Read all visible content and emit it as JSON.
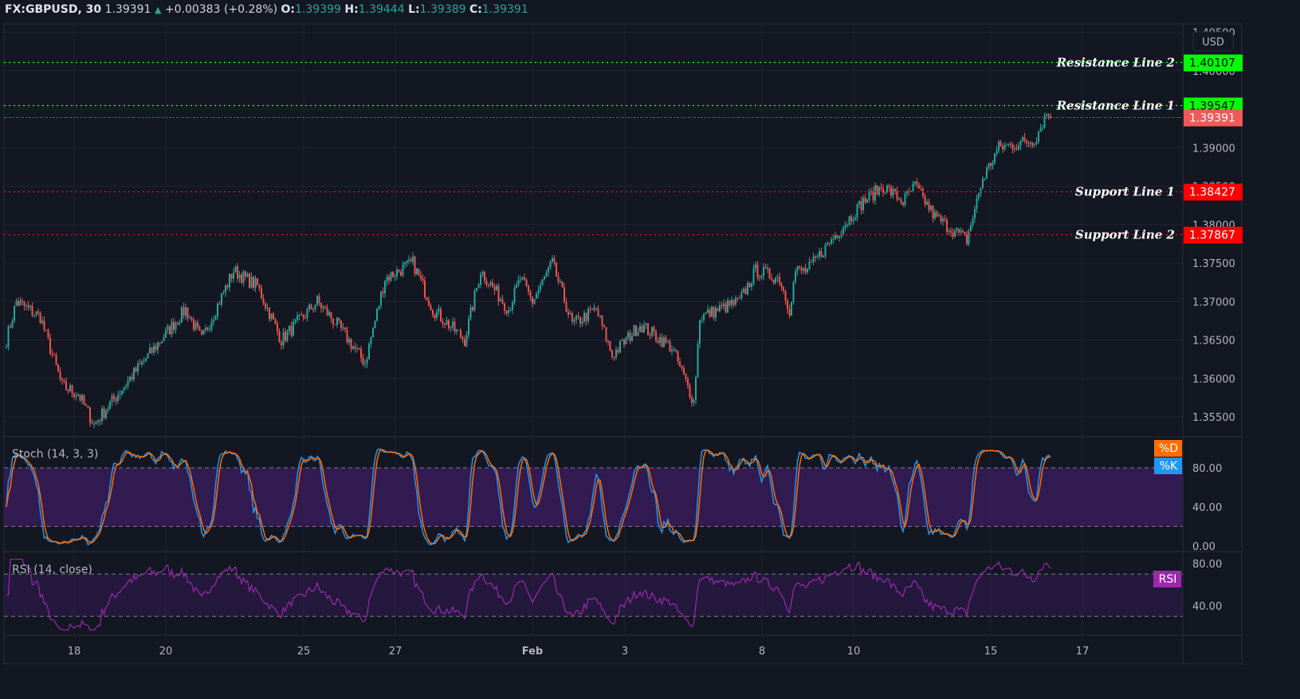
{
  "header": {
    "symbol": "FX:GBPUSD, 30",
    "last": "1.39391",
    "change": "+0.00383 (+0.28%)",
    "o_label": "O:",
    "o": "1.39399",
    "h_label": "H:",
    "h": "1.39444",
    "l_label": "L:",
    "l": "1.39389",
    "c_label": "C:",
    "c": "1.39391",
    "direction_icon": "triangle-up"
  },
  "currency": "USD",
  "colors": {
    "up": "#26a69a",
    "down": "#ef5350",
    "resistance": "#00ff00",
    "support": "#ff0000",
    "last": "#f05a5a",
    "stoch_k": "#2196f3",
    "stoch_d": "#ff6d00",
    "rsi": "#9c27b0",
    "band": "#3a1d5e"
  },
  "price_axis": [
    "1.40500",
    "1.40000",
    "1.39500",
    "1.39000",
    "1.38500",
    "1.38000",
    "1.37500",
    "1.37000",
    "1.36500",
    "1.36000",
    "1.35500"
  ],
  "levels": [
    {
      "name": "Resistance Line 2",
      "value": "1.40107",
      "type": "resistance"
    },
    {
      "name": "Resistance Line 1",
      "value": "1.39547",
      "type": "resistance"
    },
    {
      "name": "Support Line 1",
      "value": "1.38427",
      "type": "support"
    },
    {
      "name": "Support Line 2",
      "value": "1.37867",
      "type": "support"
    }
  ],
  "last_price": "1.39391",
  "stoch": {
    "title": "Stoch (14, 3, 3)",
    "axis": [
      "80.00",
      "40.00",
      "0.00"
    ],
    "upper": 80,
    "lower": 20,
    "d_label": "%D",
    "k_label": "%K"
  },
  "rsi": {
    "title": "RSI (14, close)",
    "axis": [
      "80.00",
      "40.00"
    ],
    "upper": 70,
    "lower": 30,
    "label": "RSI"
  },
  "time_axis": [
    "18",
    "20",
    "25",
    "27",
    "Feb",
    "3",
    "8",
    "10",
    "15",
    "17"
  ],
  "chart_data": {
    "type": "candlestick",
    "ylim": [
      1.35,
      1.4055
    ],
    "price_path": [
      [
        0,
        1.365
      ],
      [
        5,
        1.37
      ],
      [
        17,
        1.368
      ],
      [
        28,
        1.359
      ],
      [
        36,
        1.358
      ],
      [
        44,
        1.354
      ],
      [
        62,
        1.36
      ],
      [
        90,
        1.369
      ],
      [
        98,
        1.365
      ],
      [
        114,
        1.374
      ],
      [
        126,
        1.372
      ],
      [
        138,
        1.365
      ],
      [
        156,
        1.37
      ],
      [
        166,
        1.367
      ],
      [
        180,
        1.362
      ],
      [
        190,
        1.373
      ],
      [
        204,
        1.375
      ],
      [
        214,
        1.369
      ],
      [
        230,
        1.365
      ],
      [
        238,
        1.374
      ],
      [
        252,
        1.369
      ],
      [
        258,
        1.373
      ],
      [
        264,
        1.37
      ],
      [
        274,
        1.375
      ],
      [
        284,
        1.367
      ],
      [
        296,
        1.369
      ],
      [
        304,
        1.363
      ],
      [
        318,
        1.367
      ],
      [
        334,
        1.364
      ],
      [
        345,
        1.357
      ],
      [
        348,
        1.368
      ],
      [
        368,
        1.37
      ],
      [
        376,
        1.374
      ],
      [
        388,
        1.373
      ],
      [
        393,
        1.369
      ],
      [
        396,
        1.374
      ],
      [
        402,
        1.374
      ],
      [
        414,
        1.378
      ],
      [
        430,
        1.383
      ],
      [
        440,
        1.385
      ],
      [
        450,
        1.383
      ],
      [
        456,
        1.385
      ],
      [
        466,
        1.381
      ],
      [
        482,
        1.378
      ],
      [
        490,
        1.386
      ],
      [
        498,
        1.39
      ],
      [
        516,
        1.391
      ],
      [
        522,
        1.3945
      ],
      [
        524,
        1.3939
      ]
    ]
  }
}
